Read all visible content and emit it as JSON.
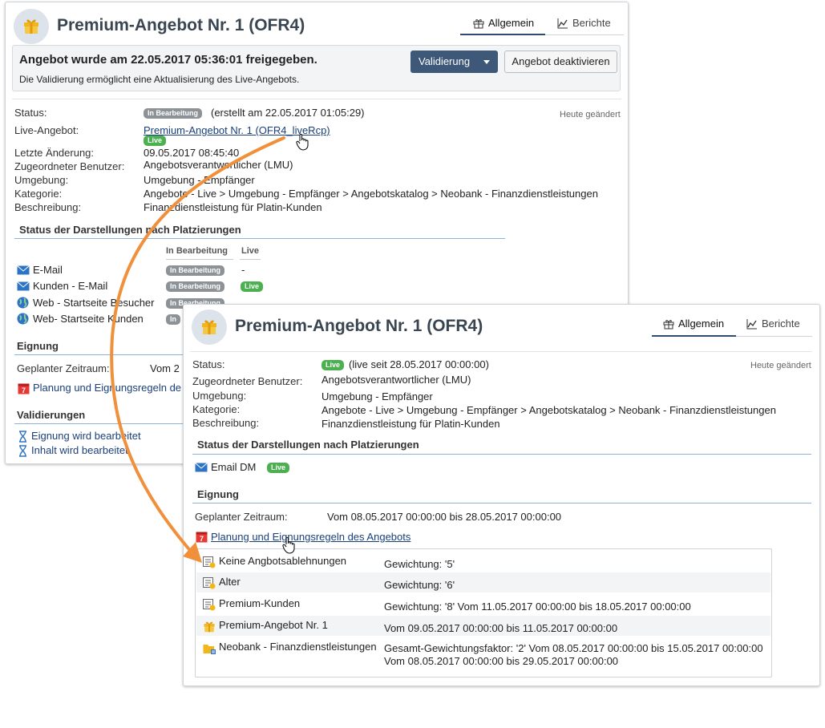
{
  "panel1": {
    "title": "Premium-Angebot Nr. 1 (OFR4)",
    "tabs": [
      {
        "label": "Allgemein",
        "icon": "gift-icon"
      },
      {
        "label": "Berichte",
        "icon": "chart-line-icon"
      }
    ],
    "banner": {
      "title": "Angebot wurde am 22.05.2017 05:36:01 freigegeben.",
      "subtitle": "Die Validierung ermöglicht eine Aktualisierung des Live-Angebots.",
      "validate_button": "Validierung",
      "deactivate_button": "Angebot deaktivieren"
    },
    "changed_today": "Heute geändert",
    "fields": {
      "status_label": "Status:",
      "status_badge": "In Bearbeitung",
      "status_text": "(erstellt am 22.05.2017 01:05:29)",
      "live_label": "Live-Angebot:",
      "live_link": "Premium-Angebot Nr. 1 (OFR4_liveRcp)",
      "live_badge": "Live",
      "last_change_label": "Letzte Änderung:",
      "last_change_value": "09.05.2017 08:45:40",
      "user_label": "Zugeordneter Benutzer:",
      "user_value": "Angebotsverantwortlicher (LMU)",
      "env_label": "Umgebung:",
      "env_value": "Umgebung - Empfänger",
      "category_label": "Kategorie:",
      "category_value": "Angebote - Live > Umgebung - Empfänger > Angebotskatalog > Neobank - Finanzdienstleistungen",
      "desc_label": "Beschreibung:",
      "desc_value": "Finanzdienstleistung für Platin-Kunden"
    },
    "placements": {
      "title": "Status der Darstellungen nach Platzierungen",
      "col_edit": "In Bearbeitung",
      "col_live": "Live",
      "rows": [
        {
          "name": "E-Mail",
          "edit": "In Bearbeitung",
          "live": "-"
        },
        {
          "name": "Kunden - E-Mail",
          "edit": "In Bearbeitung",
          "live": "Live"
        },
        {
          "name": "Web - Startseite Besucher",
          "edit": "In Bearbeitung",
          "live": ""
        },
        {
          "name": "Web- Startseite Kunden",
          "edit": "In",
          "live": ""
        }
      ]
    },
    "eligibility": {
      "title": "Eignung",
      "period_label": "Geplanter Zeitraum:",
      "period_value": "Vom 2",
      "rules_link": "Planung und Eignungsregeln de"
    },
    "validations": {
      "title": "Validierungen",
      "items": [
        "Eignung wird bearbeitet",
        "Inhalt wird bearbeitet"
      ]
    }
  },
  "panel2": {
    "title": "Premium-Angebot Nr. 1 (OFR4)",
    "tabs": [
      {
        "label": "Allgemein",
        "icon": "gift-icon"
      },
      {
        "label": "Berichte",
        "icon": "chart-line-icon"
      }
    ],
    "changed_today": "Heute geändert",
    "fields": {
      "status_label": "Status:",
      "status_badge": "Live",
      "status_text": "(live seit 28.05.2017 00:00:00)",
      "user_label": "Zugeordneter Benutzer:",
      "user_value": "Angebotsverantwortlicher (LMU)",
      "env_label": "Umgebung:",
      "env_value": "Umgebung - Empfänger",
      "category_label": "Kategorie:",
      "category_value": "Angebote - Live > Umgebung - Empfänger > Angebotskatalog > Neobank - Finanzdienstleistungen",
      "desc_label": "Beschreibung:",
      "desc_value": "Finanzdienstleistung für Platin-Kunden"
    },
    "placements": {
      "title": "Status der Darstellungen nach Platzierungen",
      "rows": [
        {
          "name": "Email DM",
          "badge": "Live"
        }
      ]
    },
    "eligibility": {
      "title": "Eignung",
      "period_label": "Geplanter Zeitraum:",
      "period_value": "Vom 08.05.2017 00:00:00 bis 28.05.2017 00:00:00",
      "rules_link": "Planung und Eignungsregeln des Angebots",
      "rules": [
        {
          "name": "Keine Angbotsablehnungen",
          "detail": "Gewichtung: '5'",
          "detail2": "",
          "icon": "rule-icon"
        },
        {
          "name": "Alter",
          "detail": "Gewichtung: '6'",
          "detail2": "",
          "icon": "rule-icon"
        },
        {
          "name": "Premium-Kunden",
          "detail": "Gewichtung: '8' Vom 11.05.2017 00:00:00 bis 18.05.2017 00:00:00",
          "detail2": "",
          "icon": "rule-icon"
        },
        {
          "name": "Premium-Angebot Nr. 1",
          "detail": "Vom 09.05.2017 00:00:00 bis 11.05.2017 00:00:00",
          "detail2": "",
          "icon": "gift-icon"
        },
        {
          "name": "Neobank - Finanzdienstleistungen",
          "detail": "Gesamt-Gewichtungsfaktor: '2' Vom 08.05.2017 00:00:00 bis 15.05.2017 00:00:00",
          "detail2": "Vom 08.05.2017 00:00:00 bis 29.05.2017 00:00:00",
          "icon": "folder-icon"
        }
      ]
    }
  },
  "colors": {
    "accent": "#3d5878",
    "link": "#1a3f7a",
    "arrow": "#f0903a",
    "live_badge": "#4caf50",
    "edit_badge": "#8d9297"
  }
}
